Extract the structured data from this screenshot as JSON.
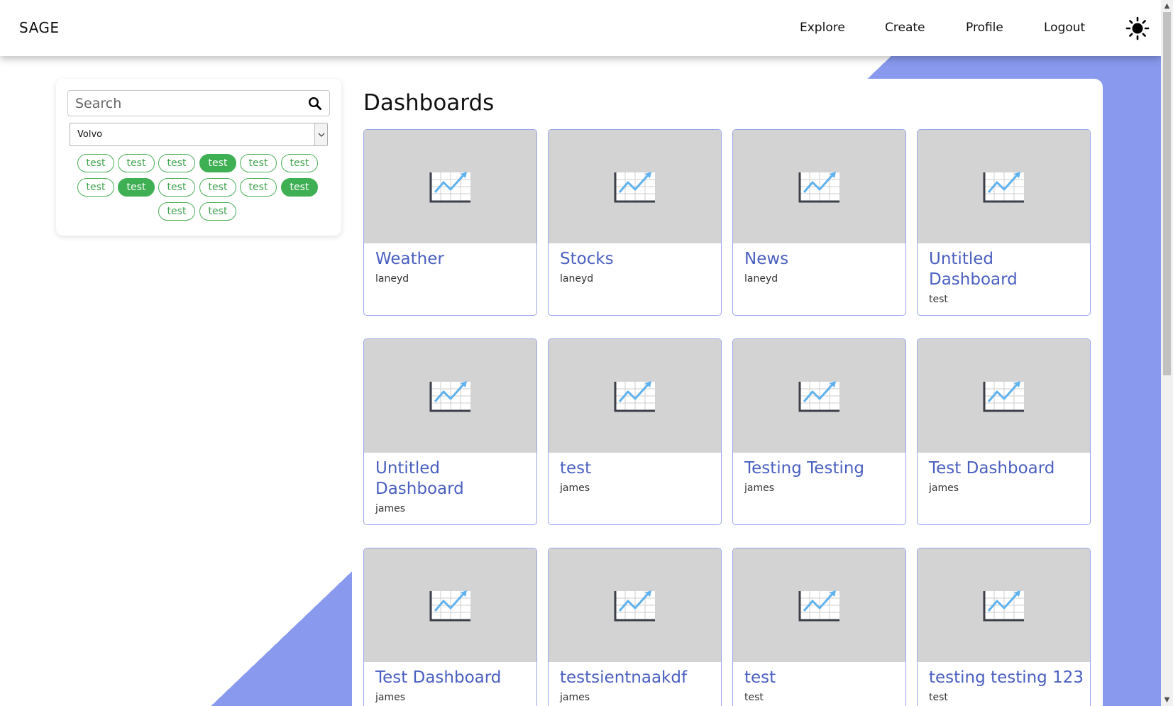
{
  "nav": {
    "brand": "SAGE",
    "links": [
      "Explore",
      "Create",
      "Profile",
      "Logout"
    ]
  },
  "sidebar": {
    "search_placeholder": "Search",
    "select_value": "Volvo",
    "tags": [
      {
        "label": "test",
        "active": false
      },
      {
        "label": "test",
        "active": false
      },
      {
        "label": "test",
        "active": false
      },
      {
        "label": "test",
        "active": true
      },
      {
        "label": "test",
        "active": false
      },
      {
        "label": "test",
        "active": false
      },
      {
        "label": "test",
        "active": false
      },
      {
        "label": "test",
        "active": true
      },
      {
        "label": "test",
        "active": false
      },
      {
        "label": "test",
        "active": false
      },
      {
        "label": "test",
        "active": false
      },
      {
        "label": "test",
        "active": true
      },
      {
        "label": "test",
        "active": false
      },
      {
        "label": "test",
        "active": false
      }
    ]
  },
  "main": {
    "title": "Dashboards",
    "cards": [
      {
        "title": "Weather",
        "author": "laneyd"
      },
      {
        "title": "Stocks",
        "author": "laneyd"
      },
      {
        "title": "News",
        "author": "laneyd"
      },
      {
        "title": "Untitled Dashboard",
        "author": "test"
      },
      {
        "title": "Untitled Dashboard",
        "author": "james"
      },
      {
        "title": "test",
        "author": "james"
      },
      {
        "title": "Testing Testing",
        "author": "james"
      },
      {
        "title": "Test Dashboard",
        "author": "james"
      },
      {
        "title": "Test Dashboard",
        "author": "james"
      },
      {
        "title": "testsientnaakdf",
        "author": "james"
      },
      {
        "title": "test",
        "author": "test"
      },
      {
        "title": "testing testing 123",
        "author": "test"
      }
    ]
  },
  "colors": {
    "accent": "#8899ee",
    "tag_green": "#3faf54",
    "card_title": "#4a5fc0",
    "thumb_bg": "#d3d3d3"
  }
}
